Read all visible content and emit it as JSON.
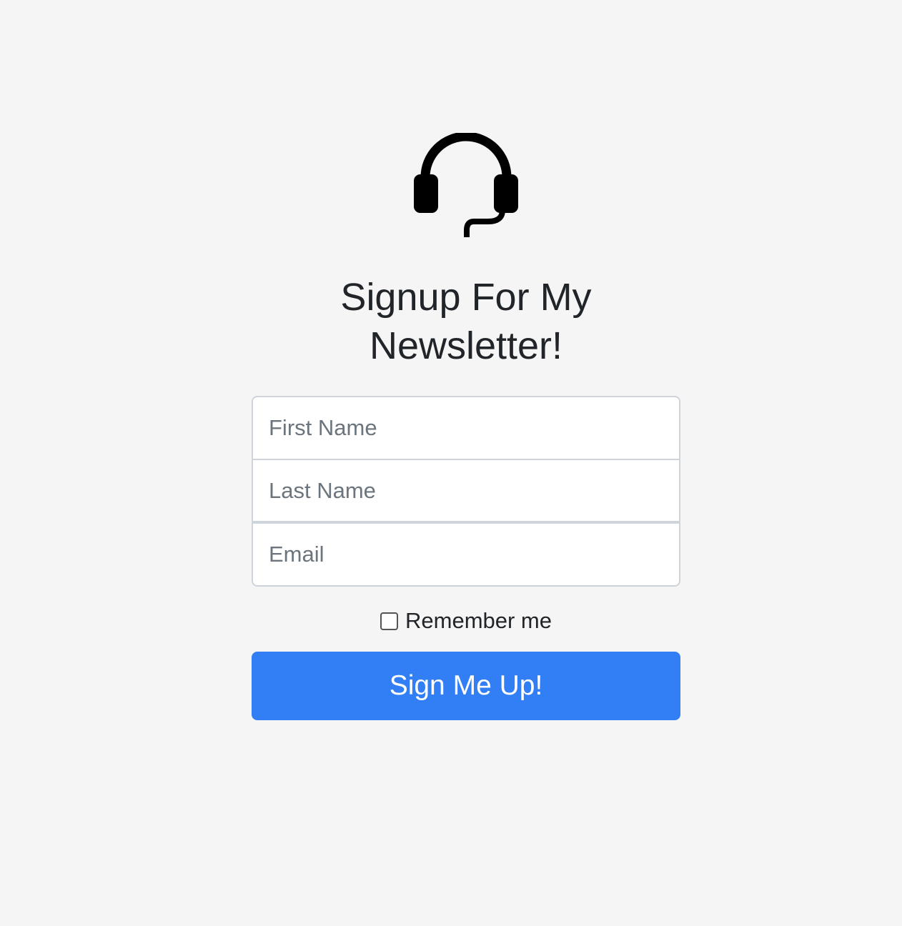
{
  "logo": {
    "icon": "headset-icon"
  },
  "title": "Signup For My Newsletter!",
  "form": {
    "first_name_placeholder": "First Name",
    "last_name_placeholder": "Last Name",
    "email_placeholder": "Email",
    "remember_label": "Remember me",
    "remember_checked": false,
    "submit_label": "Sign Me Up!"
  },
  "colors": {
    "background": "#f5f5f5",
    "primary": "#327ef5",
    "text": "#212529"
  }
}
